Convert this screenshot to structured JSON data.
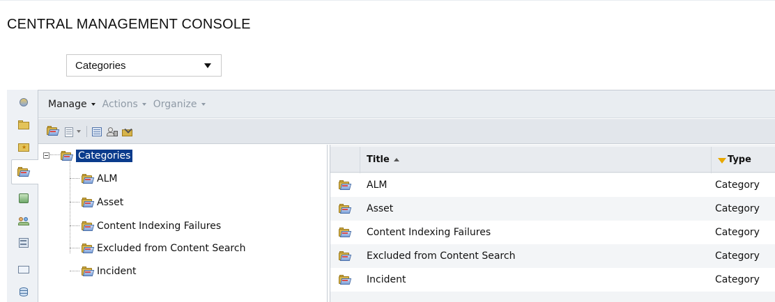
{
  "console_title": "CENTRAL MANAGEMENT CONSOLE",
  "view_selector": {
    "value": "Categories"
  },
  "menubar": {
    "manage": "Manage",
    "actions": "Actions",
    "organize": "Organize"
  },
  "tabstrip": {
    "icons": [
      "home-icon",
      "folder-icon",
      "favorites-folder-icon",
      "categories-icon",
      "personal-categories-icon",
      "users-groups-icon",
      "servers-icon",
      "inbox-icon",
      "database-icon"
    ],
    "active": "categories-icon"
  },
  "tree": {
    "root": "Categories",
    "children": [
      "ALM",
      "Asset",
      "Content Indexing Failures",
      "Excluded from Content Search",
      "Incident"
    ]
  },
  "list": {
    "columns": {
      "title": "Title",
      "type": "Type"
    },
    "rows": [
      {
        "title": "ALM",
        "type": "Category"
      },
      {
        "title": "Asset",
        "type": "Category"
      },
      {
        "title": "Content Indexing Failures",
        "type": "Category"
      },
      {
        "title": "Excluded from Content Search",
        "type": "Category"
      },
      {
        "title": "Incident",
        "type": "Category"
      }
    ]
  },
  "colors": {
    "selection": "#0a3b8c",
    "menubar_bg": "#e9edf1",
    "disabled_text": "#8f9aa6",
    "filter_icon": "#e8a800"
  }
}
